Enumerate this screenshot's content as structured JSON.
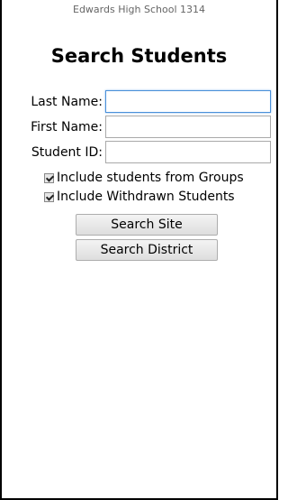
{
  "header": {
    "school": "Edwards High School 1314",
    "title": "Search Students"
  },
  "form": {
    "last_name": {
      "label": "Last Name:",
      "value": ""
    },
    "first_name": {
      "label": "First Name:",
      "value": ""
    },
    "student_id": {
      "label": "Student ID:",
      "value": ""
    },
    "include_groups": {
      "label": "Include students from Groups",
      "checked": true
    },
    "include_withdrawn": {
      "label": "Include Withdrawn Students",
      "checked": true
    }
  },
  "buttons": {
    "search_site": "Search Site",
    "search_district": "Search District"
  },
  "colors": {
    "focus_border": "#4a90d9",
    "frame_border": "#000000"
  }
}
